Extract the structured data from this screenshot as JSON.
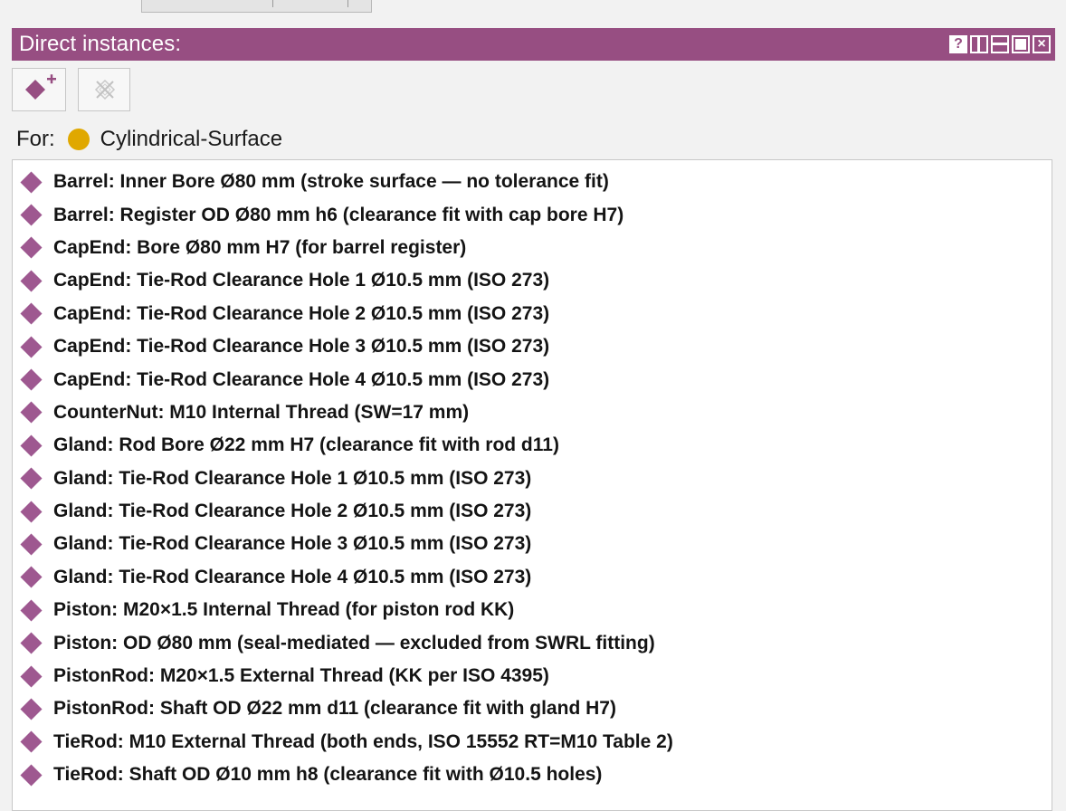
{
  "panel": {
    "title": "Direct instances:",
    "accent_color": "#974e82",
    "controls": {
      "help": "?",
      "close": "×"
    }
  },
  "toolbar": {
    "create_icon": "add-instance-icon",
    "delete_icon": "delete-instance-icon"
  },
  "for_row": {
    "label": "For:",
    "class_icon": "class-circle-icon",
    "class_color": "#e0a800",
    "class_name": "Cylindrical-Surface"
  },
  "instances": [
    "Barrel: Inner Bore Ø80 mm (stroke surface — no tolerance fit)",
    "Barrel: Register OD Ø80 mm h6 (clearance fit with cap bore H7)",
    "CapEnd: Bore Ø80 mm H7 (for barrel register)",
    "CapEnd: Tie-Rod Clearance Hole 1 Ø10.5 mm (ISO 273)",
    "CapEnd: Tie-Rod Clearance Hole 2 Ø10.5 mm (ISO 273)",
    "CapEnd: Tie-Rod Clearance Hole 3 Ø10.5 mm (ISO 273)",
    "CapEnd: Tie-Rod Clearance Hole 4 Ø10.5 mm (ISO 273)",
    "CounterNut: M10 Internal Thread (SW=17 mm)",
    "Gland: Rod Bore Ø22 mm H7 (clearance fit with rod d11)",
    "Gland: Tie-Rod Clearance Hole 1 Ø10.5 mm (ISO 273)",
    "Gland: Tie-Rod Clearance Hole 2 Ø10.5 mm (ISO 273)",
    "Gland: Tie-Rod Clearance Hole 3 Ø10.5 mm (ISO 273)",
    "Gland: Tie-Rod Clearance Hole 4 Ø10.5 mm (ISO 273)",
    "Piston: M20×1.5 Internal Thread (for piston rod KK)",
    "Piston: OD Ø80 mm (seal-mediated — excluded from SWRL fitting)",
    "PistonRod: M20×1.5 External Thread (KK per ISO 4395)",
    "PistonRod: Shaft OD Ø22 mm d11 (clearance fit with gland H7)",
    "TieRod: M10 External Thread (both ends, ISO 15552 RT=M10 Table 2)",
    "TieRod: Shaft OD Ø10 mm h8 (clearance fit with Ø10.5 holes)"
  ],
  "instance_icon": "instance-diamond-icon",
  "instance_color": "#9e5890"
}
